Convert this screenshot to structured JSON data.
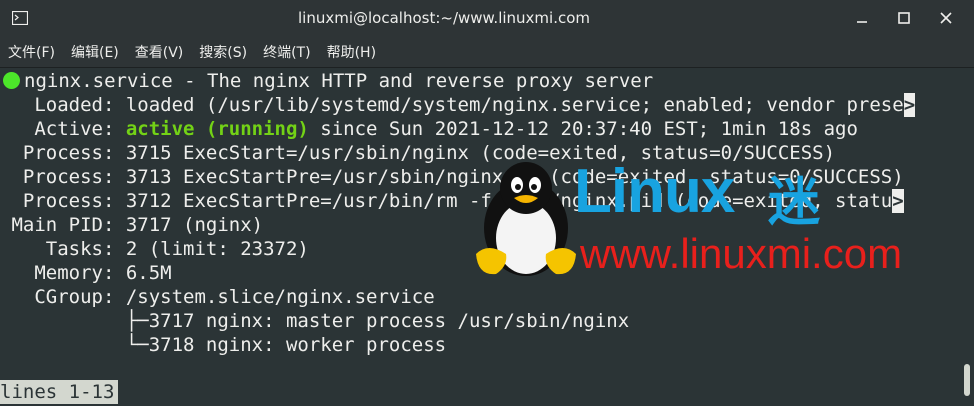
{
  "window": {
    "title": "linuxmi@localhost:~/www.linuxmi.com",
    "terminal_icon": "terminal-icon",
    "controls": [
      "minimize-icon",
      "maximize-icon",
      "close-icon"
    ]
  },
  "menu": [
    "文件(F)",
    "编辑(E)",
    "查看(V)",
    "搜索(S)",
    "终端(T)",
    "帮助(H)"
  ],
  "output": {
    "line1": "nginx.service - The nginx HTTP and reverse proxy server",
    "loaded_label": "   Loaded:",
    "loaded_value": " loaded (/usr/lib/systemd/system/nginx.service; enabled; vendor prese",
    "loaded_overflow": ">",
    "active_label": "   Active:",
    "active_state": " active (running)",
    "active_rest": " since Sun 2021-12-12 20:37:40 EST; 1min 18s ago",
    "process1": "  Process: 3715 ExecStart=/usr/sbin/nginx (code=exited, status=0/SUCCESS)",
    "process2": "  Process: 3713 ExecStartPre=/usr/sbin/nginx -t (code=exited, status=0/SUCCESS)",
    "process3": "  Process: 3712 ExecStartPre=/usr/bin/rm -f /run/nginx.pid (code=exited, statu",
    "process3_overflow": ">",
    "mainpid": " Main PID: 3717 (nginx)",
    "tasks": "    Tasks: 2 (limit: 23372)",
    "memory": "   Memory: 6.5M",
    "cgroup": "   CGroup: /system.slice/nginx.service",
    "cgroup_child1": "           ├─3717 nginx: master process /usr/sbin/nginx",
    "cgroup_child2": "           └─3718 nginx: worker process",
    "status": "lines 1-13"
  },
  "watermark": {
    "brand": "Linux",
    "brand_cn": "迷",
    "url": "www.linuxmi.com",
    "logo": "tux-penguin-logo"
  },
  "colors": {
    "background": "#2b3436",
    "text": "#eeeeec",
    "active_green": "#73d216",
    "status_dot": "#4ce62a",
    "watermark_blue": "#18a3e0",
    "watermark_red": "#e8201c"
  }
}
